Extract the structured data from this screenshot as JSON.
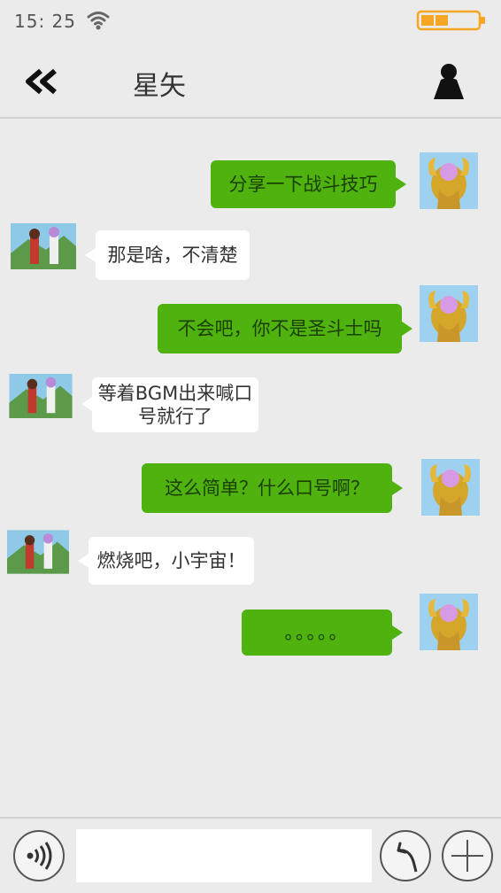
{
  "status_bar": {
    "time": "15: 25",
    "wifi_icon": "wifi-icon",
    "battery_icon": "battery-icon",
    "battery_color": "#f5a623"
  },
  "nav": {
    "title": "星矢",
    "back_icon": "double-chevron-left-icon",
    "contact_icon": "person-icon"
  },
  "messages": [
    {
      "side": "out",
      "text": "分享一下战斗技巧"
    },
    {
      "side": "in",
      "text": "那是啥，不清楚"
    },
    {
      "side": "out",
      "text": "不会吧，你不是圣斗士吗"
    },
    {
      "side": "in",
      "text": "等着BGM出来喊口\n号就行了"
    },
    {
      "side": "out",
      "text": "这么简单？什么口号啊？"
    },
    {
      "side": "in",
      "text": "燃烧吧，小宇宙！"
    },
    {
      "side": "out",
      "text": "。。。。。"
    }
  ],
  "input_bar": {
    "voice_icon": "voice-icon",
    "message_value": "",
    "send_icon": "curved-arrow-icon",
    "plus_icon": "plus-icon"
  },
  "colors": {
    "background": "#ebebeb",
    "outgoing_bubble": "#4fb20f",
    "incoming_bubble": "#ffffff"
  }
}
